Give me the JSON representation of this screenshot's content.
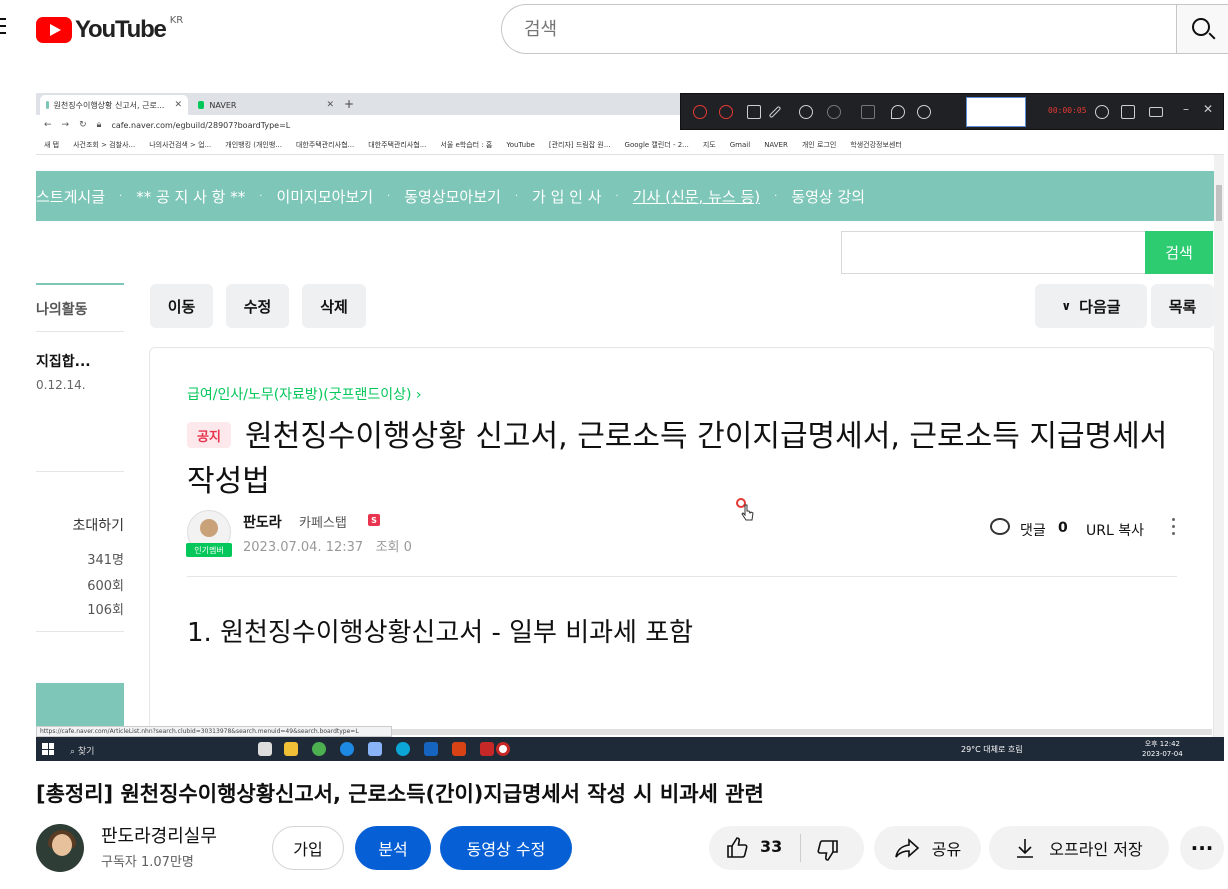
{
  "header": {
    "logo_text": "YouTube",
    "region": "KR",
    "search_placeholder": "검색"
  },
  "browser": {
    "tabs": [
      {
        "label": "원천징수이행상황 신고서, 근로..."
      },
      {
        "label": "NAVER"
      }
    ],
    "address": "cafe.naver.com/egbuild/28907?boardType=L",
    "bookmarks": [
      "새 탭",
      "사건조회 > 검찰사...",
      "나의사건검색 > 업...",
      "개인뱅킹 (개인뱅...",
      "대한주택관리사협...",
      "대한주택관리사협...",
      "서울 e학습터 : 홈",
      "YouTube",
      "[관리자] 드림잡 원...",
      "Google 캘린더 - 2...",
      "지도",
      "Gmail",
      "NAVER",
      "개인 로그인",
      "학생건강정보센터"
    ],
    "recorder_timer": "00:00:05",
    "status_url": "https://cafe.naver.com/ArticleList.nhn?search.clubid=30313978&search.menuid=49&search.boardtype=L"
  },
  "cafe": {
    "menu": [
      "스트게시글",
      "** 공 지 사 항 **",
      "이미지모아보기",
      "동영상모아보기",
      "가 입 인 사",
      "기사 (신문, 뉴스 등)",
      "동영상 강의"
    ],
    "search_button": "검색",
    "left": {
      "activity": "나의활동",
      "item_title": "지집합...",
      "item_date": "0.12.14.",
      "invite": "초대하기",
      "stats": [
        "341명",
        "600회",
        "106회"
      ]
    },
    "buttons": {
      "move": "이동",
      "edit": "수정",
      "delete": "삭제",
      "next": "다음글",
      "list": "목록"
    },
    "article": {
      "breadcrumb": "급여/인사/노무(자료방)(굿프랜드이상) ›",
      "notice": "공지",
      "title": "원천징수이행상황 신고서, 근로소득 간이지급명세서, 근로소득 지급명세서 작성법",
      "author": "판도라",
      "role": "카페스탭",
      "badge": "인기멤버",
      "staff_mark": "S",
      "date": "2023.07.04. 12:37",
      "views": "조회 0",
      "comments_label": "댓글",
      "comments_count": "0",
      "url_copy": "URL 복사",
      "body_heading": "1. 원천징수이행상황신고서 - 일부 비과세 포함"
    }
  },
  "taskbar": {
    "search": "찾기",
    "weather": "29°C 대체로 흐림",
    "time": "오후 12:42",
    "date": "2023-07-04"
  },
  "video": {
    "title": "[총정리] 원천징수이행상황신고서, 근로소득(간이)지급명세서 작성 시 비과세 관련",
    "channel": "판도라경리실무",
    "subscribers": "구독자 1.07만명",
    "join": "가입",
    "analytics": "분석",
    "edit_video": "동영상 수정",
    "likes": "33",
    "share": "공유",
    "offline": "오프라인 저장"
  },
  "colors": {
    "yt_red": "#ff0000",
    "cafe_teal": "#7dc6b8",
    "naver_green": "#03c75a",
    "yt_blue": "#065fd4"
  }
}
